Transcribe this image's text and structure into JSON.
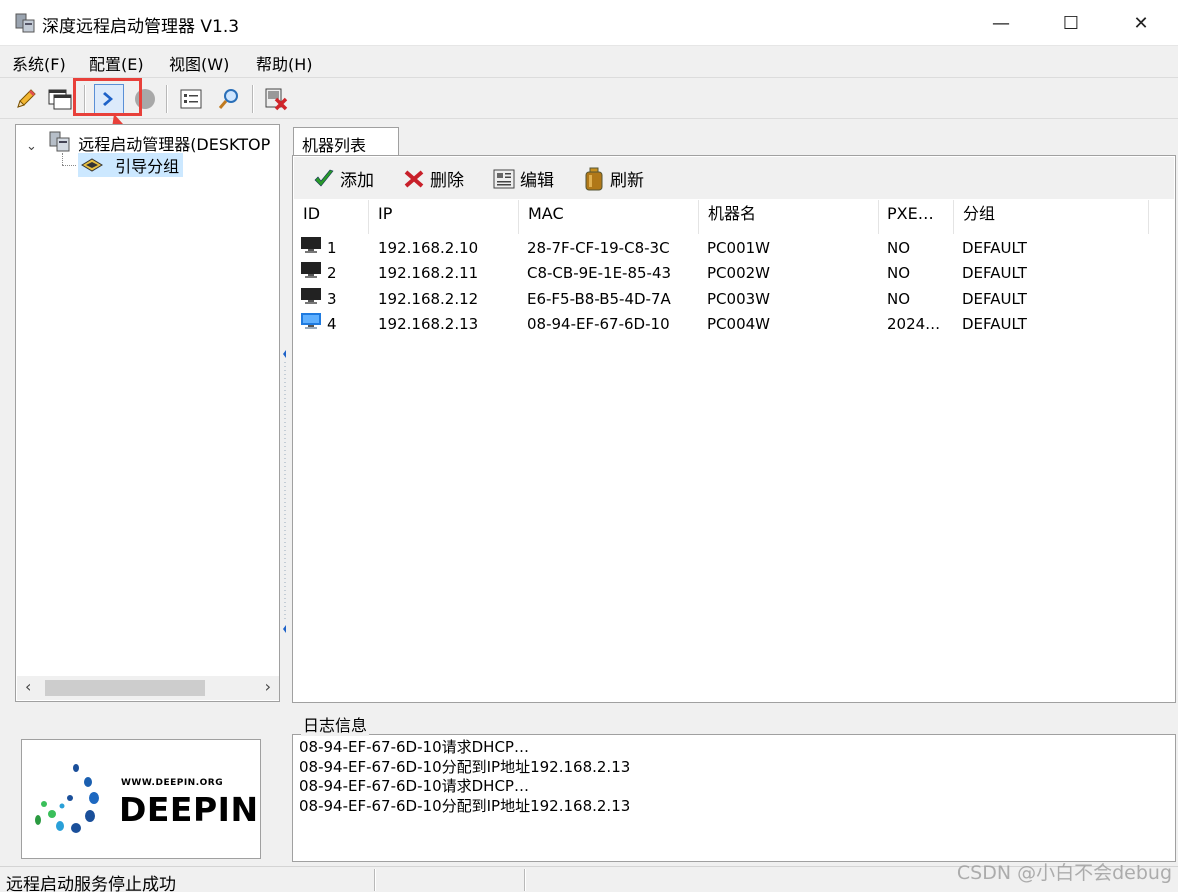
{
  "window": {
    "title": "深度远程启动管理器 V1.3",
    "minimize": "—",
    "maximize": "☐",
    "close": "✕"
  },
  "menu": [
    "系统(F)",
    "配置(E)",
    "视图(W)",
    "帮助(H)"
  ],
  "toolbar": {
    "icons": [
      "pencil-icon",
      "window-icon",
      "start-service-icon",
      "stop-service-icon",
      "list-settings-icon",
      "search-icon",
      "close-computer-icon"
    ],
    "highlighted": "start-service-icon"
  },
  "tree": {
    "root": "远程启动管理器(DESKTOP",
    "child": "引导分组"
  },
  "tabs": {
    "machine_list": "机器列表"
  },
  "actions": {
    "add": "添加",
    "delete": "删除",
    "edit": "编辑",
    "refresh": "刷新"
  },
  "table": {
    "columns": [
      "ID",
      "IP",
      "MAC",
      "机器名",
      "PXE…",
      "分组"
    ],
    "rows": [
      {
        "id": "1",
        "ip": "192.168.2.10",
        "mac": "28-7F-CF-19-C8-3C",
        "name": "PC001W",
        "pxe": "NO",
        "group": "DEFAULT",
        "icon": "monitor-dark-icon"
      },
      {
        "id": "2",
        "ip": "192.168.2.11",
        "mac": "C8-CB-9E-1E-85-43",
        "name": "PC002W",
        "pxe": "NO",
        "group": "DEFAULT",
        "icon": "monitor-dark-icon"
      },
      {
        "id": "3",
        "ip": "192.168.2.12",
        "mac": "E6-F5-B8-B5-4D-7A",
        "name": "PC003W",
        "pxe": "NO",
        "group": "DEFAULT",
        "icon": "monitor-dark-icon"
      },
      {
        "id": "4",
        "ip": "192.168.2.13",
        "mac": "08-94-EF-67-6D-10",
        "name": "PC004W",
        "pxe": "2024…",
        "group": "DEFAULT",
        "icon": "monitor-blue-icon"
      }
    ]
  },
  "logo": {
    "url": "WWW.DEEPIN.ORG",
    "name": "DEEPIN"
  },
  "log": {
    "label": "日志信息",
    "lines": [
      "08-94-EF-67-6D-10请求DHCP…",
      "08-94-EF-67-6D-10分配到IP地址192.168.2.13",
      "08-94-EF-67-6D-10请求DHCP…",
      "08-94-EF-67-6D-10分配到IP地址192.168.2.13"
    ]
  },
  "status": {
    "text": "远程启动服务停止成功"
  },
  "watermark": "CSDN @小白不会debug",
  "colors": {
    "highlight": "#e8403a",
    "selection": "#cce8ff"
  }
}
